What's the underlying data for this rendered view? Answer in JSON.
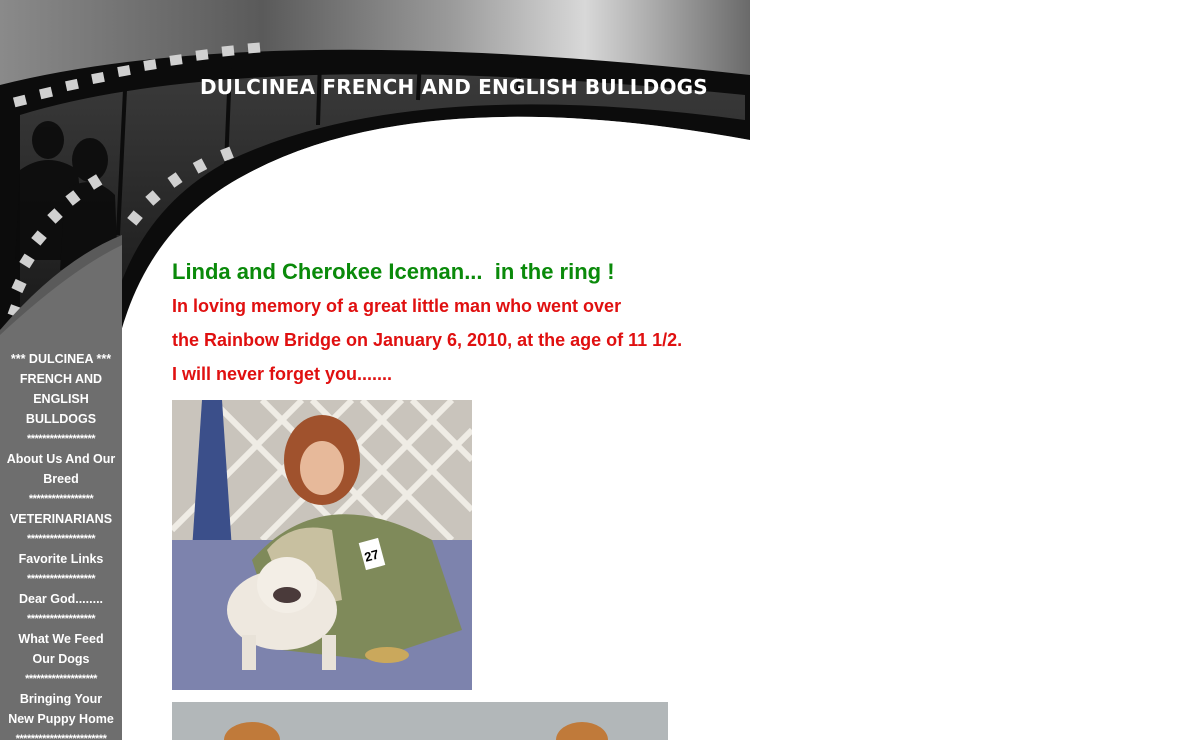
{
  "header": {
    "title": "DULCINEA FRENCH AND ENGLISH BULLDOGS"
  },
  "sidebar": {
    "items": [
      {
        "label": "***  DULCINEA *** FRENCH AND ENGLISH BULLDOGS",
        "type": "heading"
      },
      {
        "label": "******************",
        "type": "separator"
      },
      {
        "label": "About Us And Our Breed",
        "type": "link"
      },
      {
        "label": "*****************",
        "type": "separator"
      },
      {
        "label": "VETERINARIANS",
        "type": "link"
      },
      {
        "label": "******************",
        "type": "separator"
      },
      {
        "label": "Favorite Links",
        "type": "link"
      },
      {
        "label": "******************",
        "type": "separator"
      },
      {
        "label": "Dear God........",
        "type": "link"
      },
      {
        "label": "******************",
        "type": "separator"
      },
      {
        "label": "What We Feed Our Dogs",
        "type": "link"
      },
      {
        "label": "*******************",
        "type": "separator"
      },
      {
        "label": "Bringing Your New Puppy Home",
        "type": "link"
      },
      {
        "label": "************************",
        "type": "separator"
      }
    ]
  },
  "main": {
    "heading": "Linda and Cherokee Iceman...  in the ring !",
    "lines": [
      "In loving memory of a great little man who went over",
      "the Rainbow Bridge on January 6, 2010, at the age of 11 1/2.",
      "I will never forget you......."
    ],
    "badge_number": "27"
  },
  "colors": {
    "heading_green": "#0a8a0a",
    "text_red": "#e01010",
    "sidebar_gray": "#6e6e6e"
  }
}
